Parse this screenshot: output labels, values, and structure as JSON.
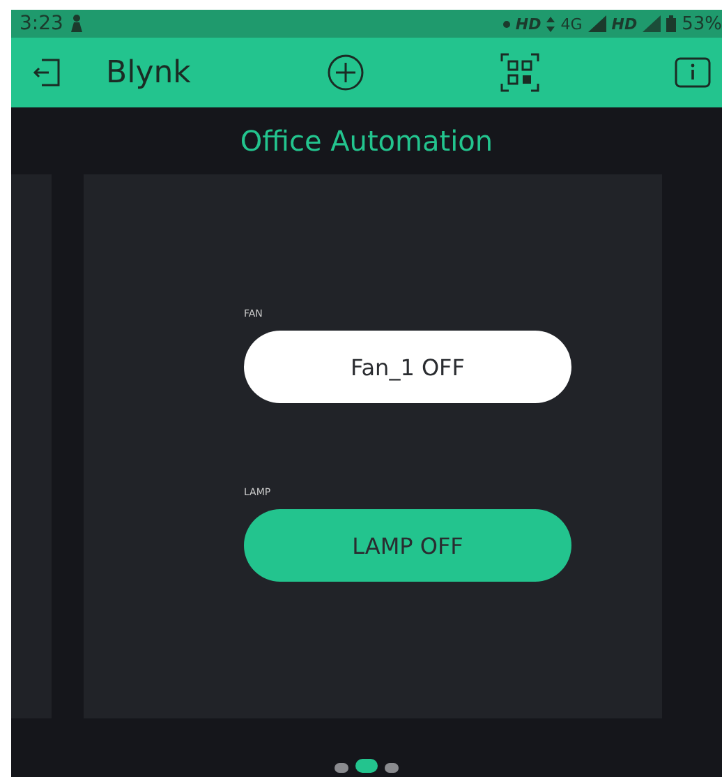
{
  "status_bar": {
    "time": "3:23",
    "network_1": "HD",
    "network_type": "4G",
    "network_2": "HD",
    "battery": "53%"
  },
  "app_bar": {
    "title": "Blynk"
  },
  "project": {
    "title": "Office Automation"
  },
  "widgets": [
    {
      "label": "FAN",
      "button_text": "Fan_1 OFF",
      "color": "#ffffff"
    },
    {
      "label": "LAMP",
      "button_text": "LAMP OFF",
      "color": "#23c48e"
    }
  ],
  "pages": [
    {
      "selected": false
    },
    {
      "selected": true
    },
    {
      "selected": false
    }
  ]
}
